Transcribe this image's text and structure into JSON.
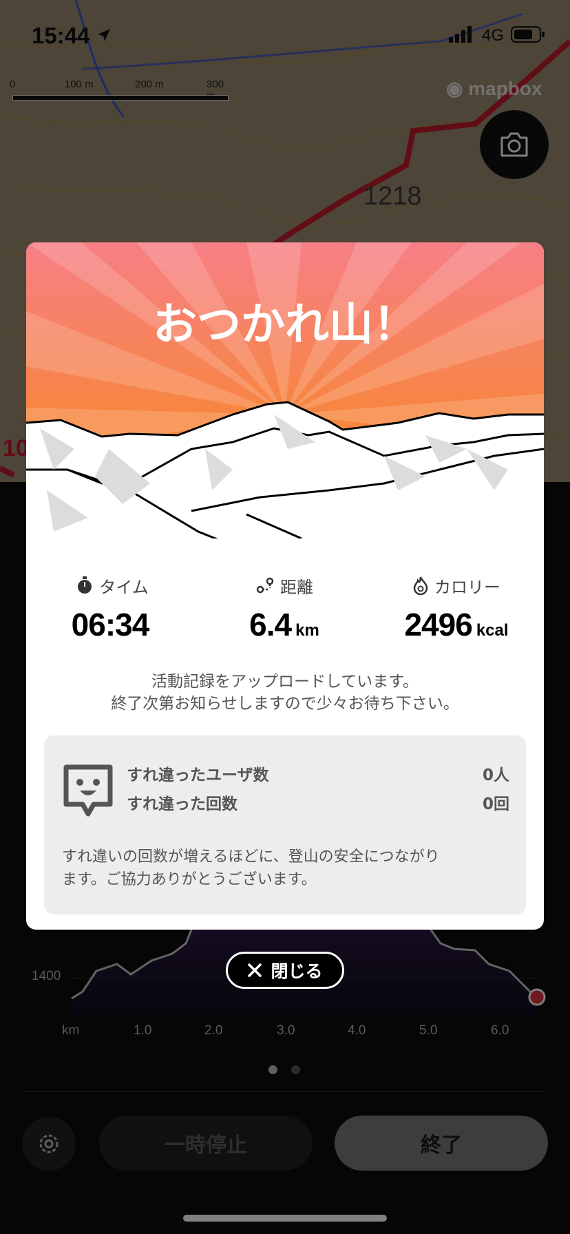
{
  "status_bar": {
    "time": "15:44",
    "network": "4G"
  },
  "map": {
    "scale_labels": [
      "0",
      "100 m",
      "200 m",
      "300 m"
    ],
    "attribution": "mapbox",
    "elevation_label": "1218",
    "side_label": "10",
    "camera_icon": "camera-icon"
  },
  "modal": {
    "title": "おつかれ山！",
    "stats": [
      {
        "icon": "stopwatch-icon",
        "label": "タイム",
        "value": "06:34",
        "unit": ""
      },
      {
        "icon": "route-icon",
        "label": "距離",
        "value": "6.4",
        "unit": "km"
      },
      {
        "icon": "flame-icon",
        "label": "カロリー",
        "value": "2496",
        "unit": "kcal"
      }
    ],
    "upload_message_1": "活動記録をアップロードしています。",
    "upload_message_2": "終了次第お知らせしますので少々お待ち下さい。",
    "encounter": {
      "users_label": "すれ違ったユーザ数",
      "users_value": "0人",
      "count_label": "すれ違った回数",
      "count_value": "0回",
      "description_1": "すれ違いの回数が増えるほどに、登山の安全につながり",
      "description_2": "ます。ご協力ありがとうございます。"
    },
    "close_label": "閉じる"
  },
  "chart": {
    "y_label": "1400",
    "x_labels": [
      "km",
      "1.0",
      "2.0",
      "3.0",
      "4.0",
      "5.0",
      "6.0"
    ]
  },
  "pager": {
    "pages": 2,
    "current": 1
  },
  "buttons": {
    "pause_label": "一時停止",
    "end_label": "終了"
  },
  "colors": {
    "accent_orange": "#f7863e",
    "route_red": "#c21a2a",
    "current_point": "#e0323c"
  }
}
